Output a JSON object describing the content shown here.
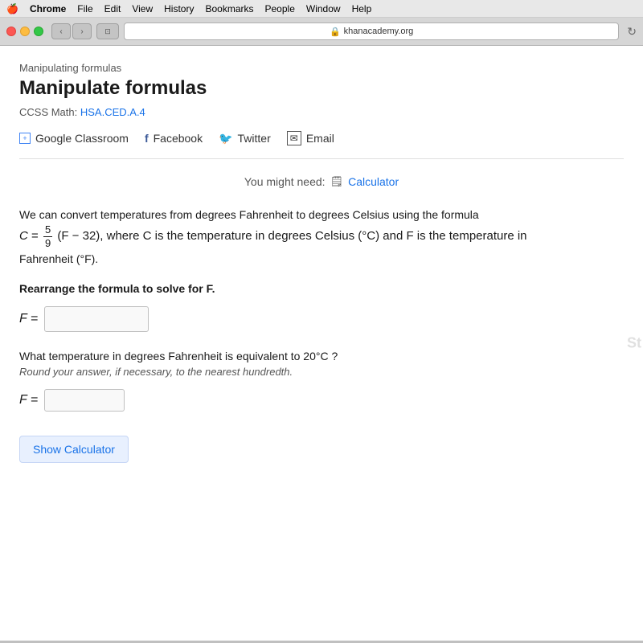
{
  "menu_bar": {
    "apple": "🍎",
    "items": [
      "Chrome",
      "File",
      "Edit",
      "View",
      "History",
      "Bookmarks",
      "People",
      "Window",
      "Help"
    ]
  },
  "browser": {
    "back_label": "‹",
    "forward_label": "›",
    "tab_icon": "⊡",
    "address": "khanacademy.org",
    "lock_icon": "🔒",
    "refresh": "↻"
  },
  "breadcrumb": "Manipulating formulas",
  "page_title": "Manipulate formulas",
  "ccss_label": "CCSS Math:",
  "ccss_link_text": "HSA.CED.A.4",
  "share": {
    "google_label": "Google Classroom",
    "facebook_label": "Facebook",
    "twitter_label": "Twitter",
    "email_label": "Email"
  },
  "calculator_note": "You might need:",
  "calculator_label": "Calculator",
  "problem": {
    "intro": "We can convert temperatures from degrees Fahrenheit to degrees Celsius using the formula",
    "formula_intro": "C =",
    "fraction_num": "5",
    "fraction_den": "9",
    "formula_rest": "(F − 32), where C is the temperature in degrees Celsius (°C) and F is the temperature in",
    "formula_end": "Fahrenheit (°F)."
  },
  "rearrange_instruction": "Rearrange the formula to solve for F.",
  "first_answer": {
    "label": "F =",
    "placeholder": ""
  },
  "question_2": "What temperature in degrees Fahrenheit is equivalent to 20°C ?",
  "hint_text": "Round your answer, if necessary, to the nearest hundredth.",
  "second_answer": {
    "label": "F =",
    "placeholder": ""
  },
  "show_calculator_btn": "Show Calculator",
  "right_peek": "St"
}
